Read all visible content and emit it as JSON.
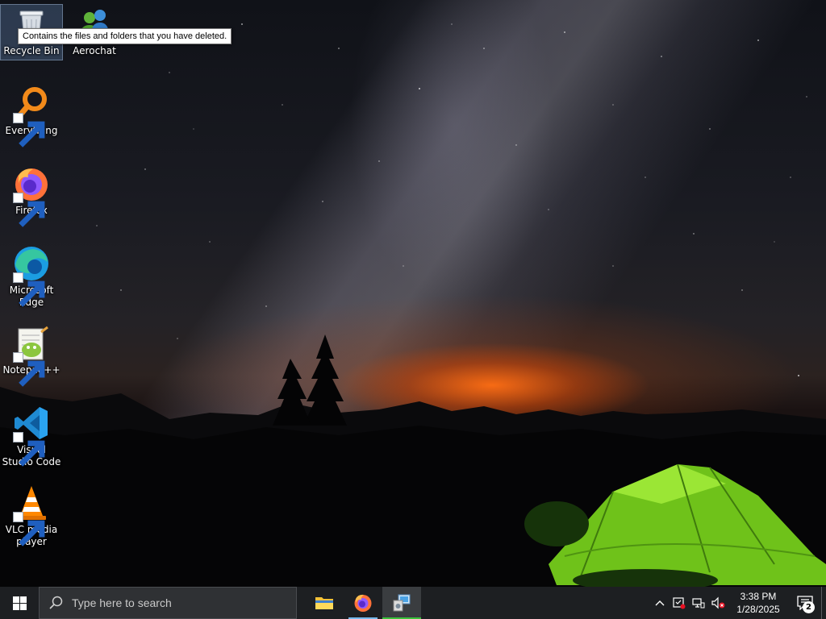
{
  "desktop": {
    "icons": [
      {
        "label": "Recycle Bin",
        "icon": "recycle-bin-icon"
      },
      {
        "label": "Aerochat",
        "icon": "aerochat-icon"
      },
      {
        "label": "Everything",
        "icon": "everything-search-icon"
      },
      {
        "label": "Firefox",
        "icon": "firefox-icon"
      },
      {
        "label": "Microsoft Edge",
        "icon": "edge-icon"
      },
      {
        "label": "Notepad++",
        "icon": "notepadpp-icon"
      },
      {
        "label": "Visual Studio Code",
        "icon": "vscode-icon"
      },
      {
        "label": "VLC media player",
        "icon": "vlc-icon"
      }
    ],
    "tooltip": "Contains the files and folders that you have deleted."
  },
  "taskbar": {
    "search_placeholder": "Type here to search",
    "pinned": [
      "file-explorer-icon",
      "firefox-icon",
      "control-panel-icon"
    ],
    "tray": {
      "time": "3:38 PM",
      "date": "1/28/2025",
      "notification_count": "2"
    }
  },
  "colors": {
    "taskbar": "#1d1f22",
    "search_box": "#2f3134",
    "tent_green": "#7ed321",
    "horizon_glow": "#ff6e14",
    "active_indicator": "#3ac23a"
  }
}
